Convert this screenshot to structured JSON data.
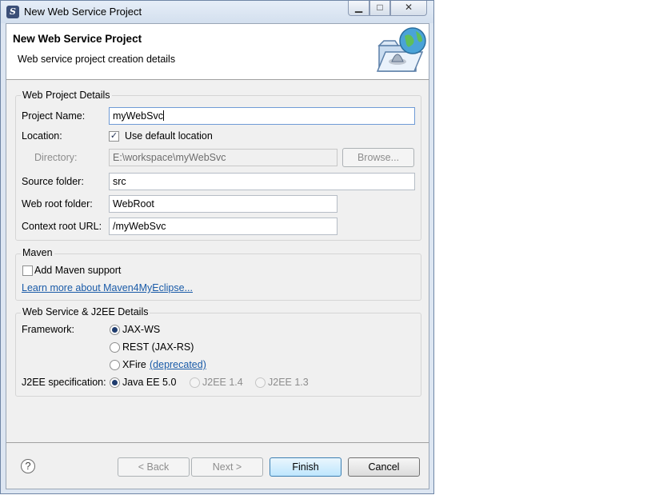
{
  "window": {
    "title": "New Web Service Project",
    "icon": "myeclipse-app-icon"
  },
  "caption_buttons": {
    "minimize": "▁",
    "maximize": "□",
    "close": "✕"
  },
  "header": {
    "title": "New Web Service Project",
    "description": "Web service project creation details",
    "graphic": "folder-globe-wizard-icon"
  },
  "web_project_details": {
    "group_label": "Web Project Details",
    "project_name_label": "Project Name:",
    "project_name_value": "myWebSvc",
    "location_label": "Location:",
    "use_default_location_label": "Use default location",
    "use_default_location_checked": true,
    "directory_label": "Directory:",
    "directory_value": "E:\\workspace\\myWebSvc",
    "browse_label": "Browse...",
    "source_folder_label": "Source folder:",
    "source_folder_value": "src",
    "web_root_label": "Web root folder:",
    "web_root_value": "WebRoot",
    "context_root_label": "Context root URL:",
    "context_root_value": "/myWebSvc"
  },
  "maven": {
    "group_label": "Maven",
    "add_support_label": "Add Maven support",
    "add_support_checked": false,
    "learn_more_link": "Learn more about Maven4MyEclipse..."
  },
  "ws_details": {
    "group_label": "Web Service & J2EE Details",
    "framework_label": "Framework:",
    "framework_options": [
      "JAX-WS",
      "REST (JAX-RS)",
      "XFire"
    ],
    "framework_selected": "JAX-WS",
    "deprecated_link": "(deprecated)",
    "j2ee_label": "J2EE specification:",
    "j2ee_options": [
      "Java EE 5.0",
      "J2EE 1.4",
      "J2EE 1.3"
    ],
    "j2ee_selected": "Java EE 5.0"
  },
  "footer": {
    "help_icon": "?",
    "back_label": "< Back",
    "next_label": "Next >",
    "finish_label": "Finish",
    "cancel_label": "Cancel"
  }
}
